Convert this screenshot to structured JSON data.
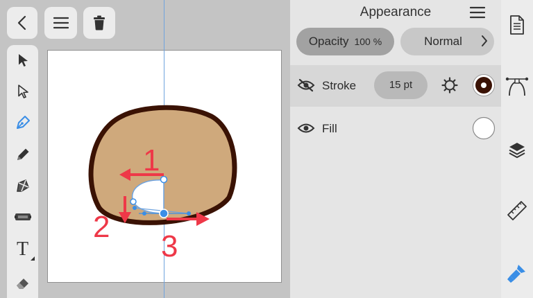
{
  "top_bar": {
    "back_icon": "chevron-left-icon",
    "menu_icon": "hamburger-icon",
    "trash_icon": "trash-icon"
  },
  "tools": [
    {
      "name": "selection-tool",
      "icon": "arrow-filled-icon"
    },
    {
      "name": "direct-selection-tool",
      "icon": "arrow-outline-icon"
    },
    {
      "name": "pen-tool",
      "icon": "pen-nib-icon",
      "active": true
    },
    {
      "name": "pencil-tool",
      "icon": "pencil-icon"
    },
    {
      "name": "shape-builder-tool",
      "icon": "shape-icon"
    },
    {
      "name": "ruler-tool",
      "icon": "ruler-tool-icon"
    },
    {
      "name": "text-tool",
      "icon": "text-icon",
      "label": "T"
    },
    {
      "name": "eraser-tool",
      "icon": "eraser-icon"
    }
  ],
  "annotations": [
    "1",
    "2",
    "3"
  ],
  "panel": {
    "title": "Appearance",
    "opacity_label": "Opacity",
    "opacity_value": "100 %",
    "blend_mode": "Normal",
    "stroke": {
      "label": "Stroke",
      "size": "15 pt",
      "visible": false,
      "color": "#3a1204"
    },
    "fill": {
      "label": "Fill",
      "visible": true,
      "color": "#ffffff"
    }
  },
  "colors": {
    "accent": "#3a8ee6",
    "annotation_red": "#ee3848",
    "shape_fill": "#cfa97c",
    "shape_stroke": "#3a1204"
  },
  "right_sidebar": [
    {
      "name": "document-icon"
    },
    {
      "name": "path-anchor-icon"
    },
    {
      "name": "layers-icon"
    },
    {
      "name": "ruler-icon"
    },
    {
      "name": "appearance-brush-icon",
      "active": true
    }
  ]
}
